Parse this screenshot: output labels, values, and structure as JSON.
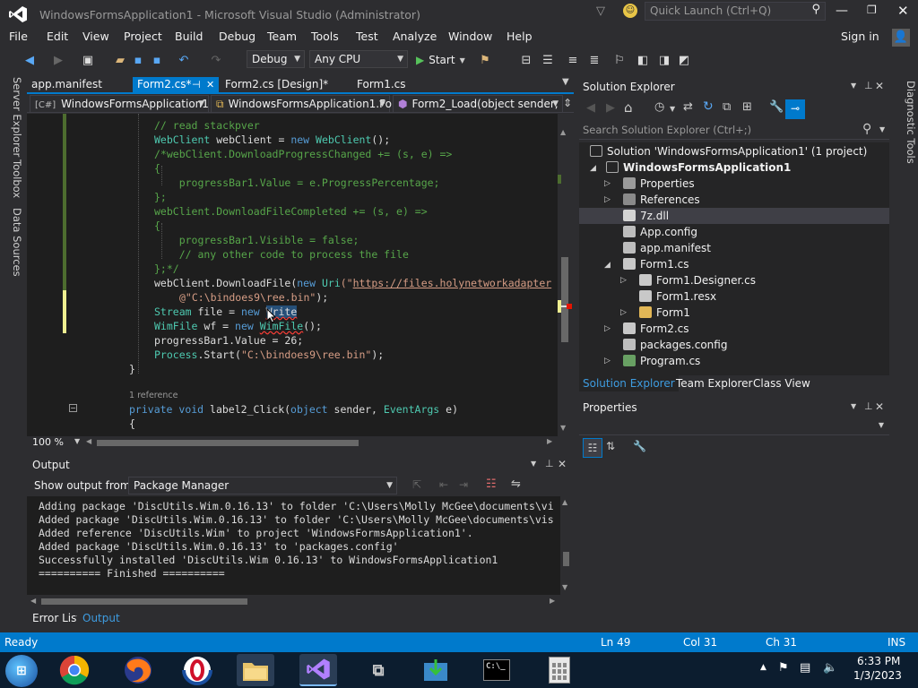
{
  "window": {
    "title": "WindowsFormsApplication1 - Microsoft Visual Studio (Administrator)",
    "quick_launch_placeholder": "Quick Launch (Ctrl+Q)"
  },
  "menu": [
    "File",
    "Edit",
    "View",
    "Project",
    "Build",
    "Debug",
    "Team",
    "Tools",
    "Test",
    "Analyze",
    "Window",
    "Help"
  ],
  "sign_in": "Sign in",
  "toolbar": {
    "config": "Debug",
    "platform": "Any CPU",
    "start_label": "Start"
  },
  "side_tabs": [
    "Server Explorer",
    "Toolbox",
    "Data Sources"
  ],
  "right_side_tab": "Diagnostic Tools",
  "doc_tabs": [
    {
      "label": "app.manifest"
    },
    {
      "label": "Form2.cs*"
    },
    {
      "label": "Form2.cs [Design]*"
    },
    {
      "label": "Form1.cs"
    }
  ],
  "nav_bar": {
    "project": "WindowsFormsApplication1",
    "class": "WindowsFormsApplication1.Fo",
    "member": "Form2_Load(object sender, Eve"
  },
  "code": {
    "l1": "// read stackpver",
    "l2a": "WebClient",
    "l2b": " webClient = ",
    "l2c": "new",
    "l2d": " ",
    "l2e": "WebClient",
    "l2f": "();",
    "l3": "/*webClient.DownloadProgressChanged += (s, e) =>",
    "l4": "{",
    "l5": "    progressBar1.Value = e.ProgressPercentage;",
    "l6": "};",
    "l7": "webClient.DownloadFileCompleted += (s, e) =>",
    "l8": "{",
    "l9": "    progressBar1.Visible = false;",
    "l10": "    // any other code to process the file",
    "l11": "};*/",
    "l12a": "webClient.DownloadFile(",
    "l12b": "new",
    "l12c": " ",
    "l12d": "Uri",
    "l12e": "(\"",
    "l12f": "https://files.holynetworkadapter",
    "l13": "@\"C:\\bindoes9\\ree.bin\"",
    "l13b": ");",
    "l14a": "Stream",
    "l14b": " file = ",
    "l14c": "new",
    "l14d": " ",
    "l14e": "Write",
    "l15a": "WimFile",
    "l15b": " wf = ",
    "l15c": "new",
    "l15d": " ",
    "l15e": "WimFile",
    "l15f": "();",
    "l16": "progressBar1.Value = 26;",
    "l17a": "Process",
    "l17b": ".Start(",
    "l17c": "\"C:\\bindoes9\\ree.bin\"",
    "l17d": ");",
    "l18": "}",
    "ref": "1 reference",
    "l19a": "private",
    "l19b": " ",
    "l19c": "void",
    "l19d": " label2_Click(",
    "l19e": "object",
    "l19f": " sender, ",
    "l19g": "EventArgs",
    "l19h": " e)",
    "l20": "{"
  },
  "zoom": "100 %",
  "output": {
    "title": "Output",
    "show_from_label": "Show output from:",
    "source": "Package Manager",
    "lines": [
      "Adding package 'DiscUtils.Wim.0.16.13' to folder 'C:\\Users\\Molly McGee\\documents\\vi",
      "Added package 'DiscUtils.Wim.0.16.13' to folder 'C:\\Users\\Molly McGee\\documents\\vis",
      "Added reference 'DiscUtils.Wim' to project 'WindowsFormsApplication1'.",
      "Added package 'DiscUtils.Wim.0.16.13' to 'packages.config'",
      "Successfully installed 'DiscUtils.Wim 0.16.13' to WindowsFormsApplication1",
      "========== Finished =========="
    ]
  },
  "bottom_tabs": [
    "Error List",
    "Output"
  ],
  "solution_explorer": {
    "title": "Solution Explorer",
    "search_placeholder": "Search Solution Explorer (Ctrl+;)",
    "items": [
      "Solution 'WindowsFormsApplication1' (1 project)",
      "WindowsFormsApplication1",
      "Properties",
      "References",
      "7z.dll",
      "App.config",
      "app.manifest",
      "Form1.cs",
      "Form1.Designer.cs",
      "Form1.resx",
      "Form1",
      "Form2.cs",
      "packages.config",
      "Program.cs"
    ],
    "tabs": [
      "Solution Explorer",
      "Team Explorer",
      "Class View"
    ]
  },
  "properties": {
    "title": "Properties"
  },
  "status": {
    "ready": "Ready",
    "ln": "Ln 49",
    "col": "Col 31",
    "ch": "Ch 31",
    "ins": "INS"
  },
  "taskbar": {
    "time": "6:33 PM",
    "date": "1/3/2023"
  },
  "colors": {
    "accent": "#007acc",
    "bg": "#2d2d30",
    "editor": "#1e1e1e"
  }
}
